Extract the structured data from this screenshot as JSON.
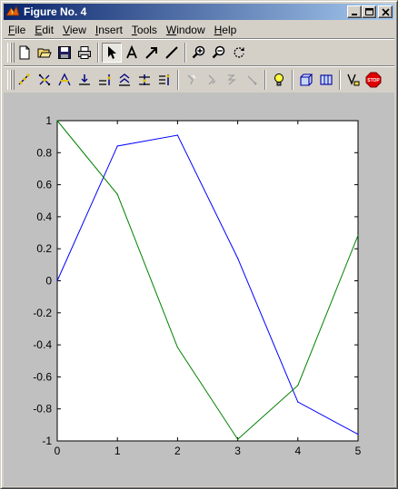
{
  "window": {
    "title": "Figure No. 4",
    "icon": "matlab-logo-icon"
  },
  "menu": [
    "File",
    "Edit",
    "View",
    "Insert",
    "Tools",
    "Window",
    "Help"
  ],
  "menu_underline": [
    "F",
    "E",
    "V",
    "I",
    "T",
    "W",
    "H"
  ],
  "toolbar1": [
    "new-figure-icon",
    "open-file-icon",
    "save-icon",
    "print-icon",
    "edit-plot-arrow-icon",
    "insert-text-icon",
    "insert-arrow-icon",
    "insert-line-icon",
    "zoom-in-icon",
    "zoom-out-icon",
    "rotate-3d-icon"
  ],
  "toolbar2": [
    "select-points-icon",
    "select-region-icon",
    "select-trace-icon",
    "select-axis-icon",
    "select-group-icon",
    "select-layer-icon",
    "select-stack-icon",
    "select-align-icon",
    "disabled-tool-1-icon",
    "disabled-tool-2-icon",
    "disabled-tool-3-icon",
    "disabled-tool-4-icon",
    "lightbulb-icon",
    "box-3d-icon",
    "box-3d-alt-icon",
    "select-yellow-icon",
    "stop-icon"
  ],
  "stop_label": "STOP",
  "chart_data": {
    "type": "line",
    "title": "",
    "xlabel": "",
    "ylabel": "",
    "xlim": [
      0,
      5
    ],
    "ylim": [
      -1,
      1
    ],
    "x": [
      0,
      1,
      2,
      3,
      4,
      5
    ],
    "xticks": [
      "0",
      "1",
      "2",
      "3",
      "4",
      "5"
    ],
    "yticks": [
      "1",
      "0.8",
      "0.6",
      "0.4",
      "0.2",
      "0",
      "-0.2",
      "-0.4",
      "-0.6",
      "-0.8",
      "-1"
    ],
    "grid": false,
    "series": [
      {
        "color": "#0000ff",
        "values": [
          0,
          0.8415,
          0.9093,
          0.1411,
          -0.7568,
          -0.9589
        ]
      },
      {
        "color": "#008000",
        "values": [
          1,
          0.5403,
          -0.4161,
          -0.99,
          -0.6536,
          0.2837
        ]
      }
    ]
  }
}
